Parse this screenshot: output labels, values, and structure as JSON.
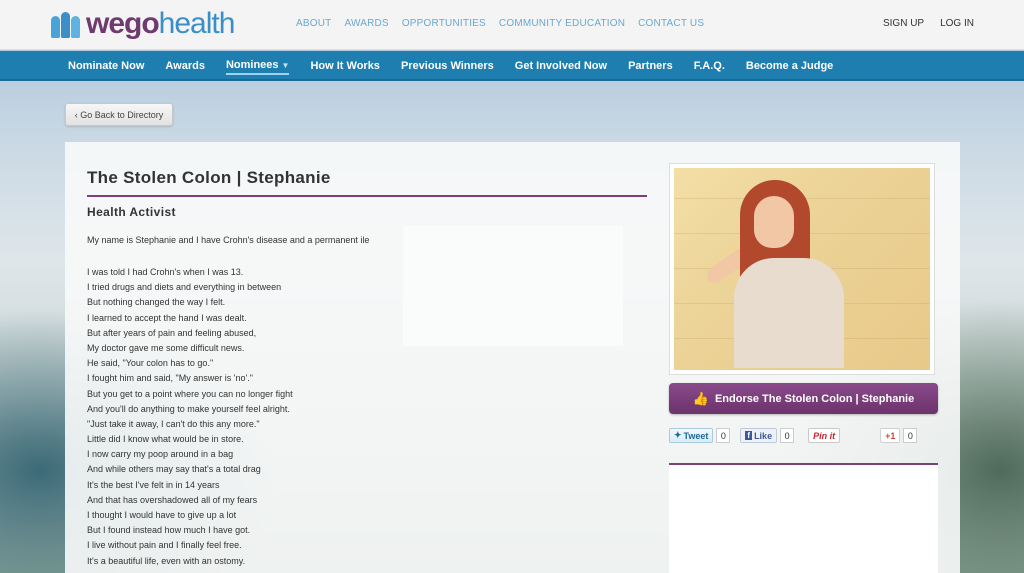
{
  "brand": {
    "wego": "wego",
    "health": "health"
  },
  "top_nav": [
    "ABOUT",
    "AWARDS",
    "OPPORTUNITIES",
    "COMMUNITY EDUCATION",
    "CONTACT US"
  ],
  "auth": {
    "signup": "SIGN UP",
    "login": "LOG IN"
  },
  "main_nav": [
    "Nominate Now",
    "Awards",
    "Nominees",
    "How It Works",
    "Previous Winners",
    "Get Involved Now",
    "Partners",
    "F.A.Q.",
    "Become a Judge"
  ],
  "back_button": "‹ Go Back to Directory",
  "profile": {
    "title": "The Stolen Colon | Stephanie",
    "role": "Health Activist",
    "intro": "My name is Stephanie and I have Crohn's disease and a permanent ile",
    "poem": [
      "I was told I had Crohn's when I was 13.",
      "I tried drugs and diets and everything in between",
      "But nothing changed the way I felt.",
      "I learned to accept the hand I was dealt.",
      "But after years of pain and feeling abused,",
      "My doctor gave me some difficult news.",
      "He said, \"Your colon has to go.\"",
      "I fought him and said, \"My answer is 'no'.\"",
      "But you get to a point where you can no longer fight",
      "And you'll do anything to make yourself feel alright.",
      "\"Just take it away, I can't do this any more.\"",
      "Little did I know what would be in store.",
      "I now carry my poop around in a bag",
      "And while others may say that's a total drag",
      "It's the best I've felt in in 14 years",
      "And that has overshadowed all of my fears",
      "I thought I would have to give up a lot",
      "But I found instead how much I have got.",
      "I live without pain and I finally feel free.",
      "It's a beautiful life, even with an ostomy."
    ]
  },
  "endorse": {
    "icon": "thumbs-up-icon",
    "label": "Endorse The Stolen Colon | Stephanie"
  },
  "share": {
    "tweet": "Tweet",
    "tweet_count": "0",
    "like": "Like",
    "like_count": "0",
    "pin": "Pin it",
    "gplus": "+1",
    "gplus_count": "0"
  },
  "colors": {
    "purple": "#7c3f7c",
    "nav_blue": "#1e7eb0",
    "link_blue": "#6aa8cf"
  }
}
